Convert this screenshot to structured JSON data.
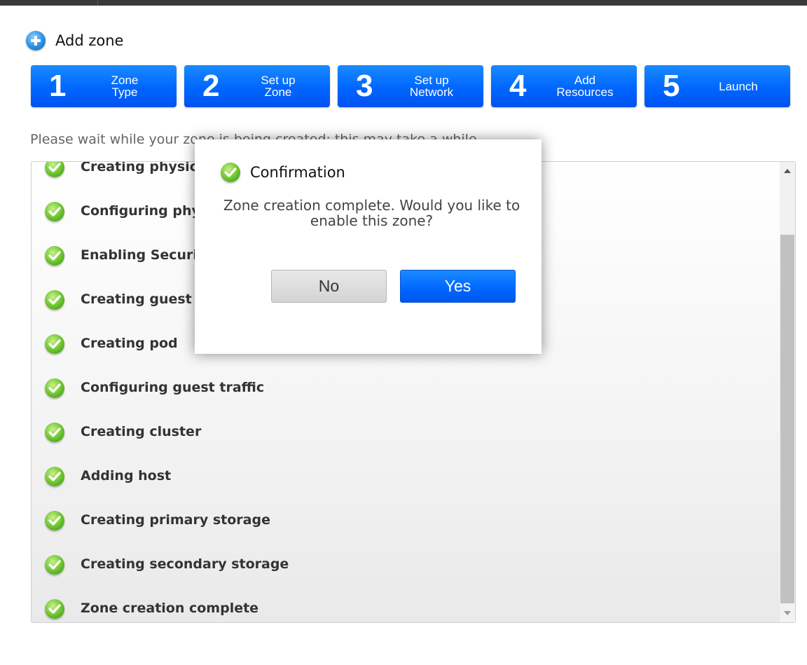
{
  "header": {
    "title": "Add zone",
    "icon": "add-circle-icon"
  },
  "steps": [
    {
      "number": "1",
      "label": "Zone\nType"
    },
    {
      "number": "2",
      "label": "Set up\nZone"
    },
    {
      "number": "3",
      "label": "Set up\nNetwork"
    },
    {
      "number": "4",
      "label": "Add\nResources"
    },
    {
      "number": "5",
      "label": "Launch"
    }
  ],
  "wait_text": "Please wait while your zone is being created; this may take a while...",
  "progress_items": [
    {
      "label": "Creating physical networks",
      "status": "done"
    },
    {
      "label": "Configuring physical networks",
      "status": "done"
    },
    {
      "label": "Enabling Security Group provider",
      "status": "done"
    },
    {
      "label": "Creating guest network",
      "status": "done"
    },
    {
      "label": "Creating pod",
      "status": "done"
    },
    {
      "label": "Configuring guest traffic",
      "status": "done"
    },
    {
      "label": "Creating cluster",
      "status": "done"
    },
    {
      "label": "Adding host",
      "status": "done"
    },
    {
      "label": "Creating primary storage",
      "status": "done"
    },
    {
      "label": "Creating secondary storage",
      "status": "done"
    },
    {
      "label": "Zone creation complete",
      "status": "done"
    }
  ],
  "dialog": {
    "title": "Confirmation",
    "message": "Zone creation complete. Would you like to enable this zone?",
    "no_label": "No",
    "yes_label": "Yes"
  },
  "colors": {
    "accent": "#0066ff",
    "success": "#5bbf22"
  }
}
